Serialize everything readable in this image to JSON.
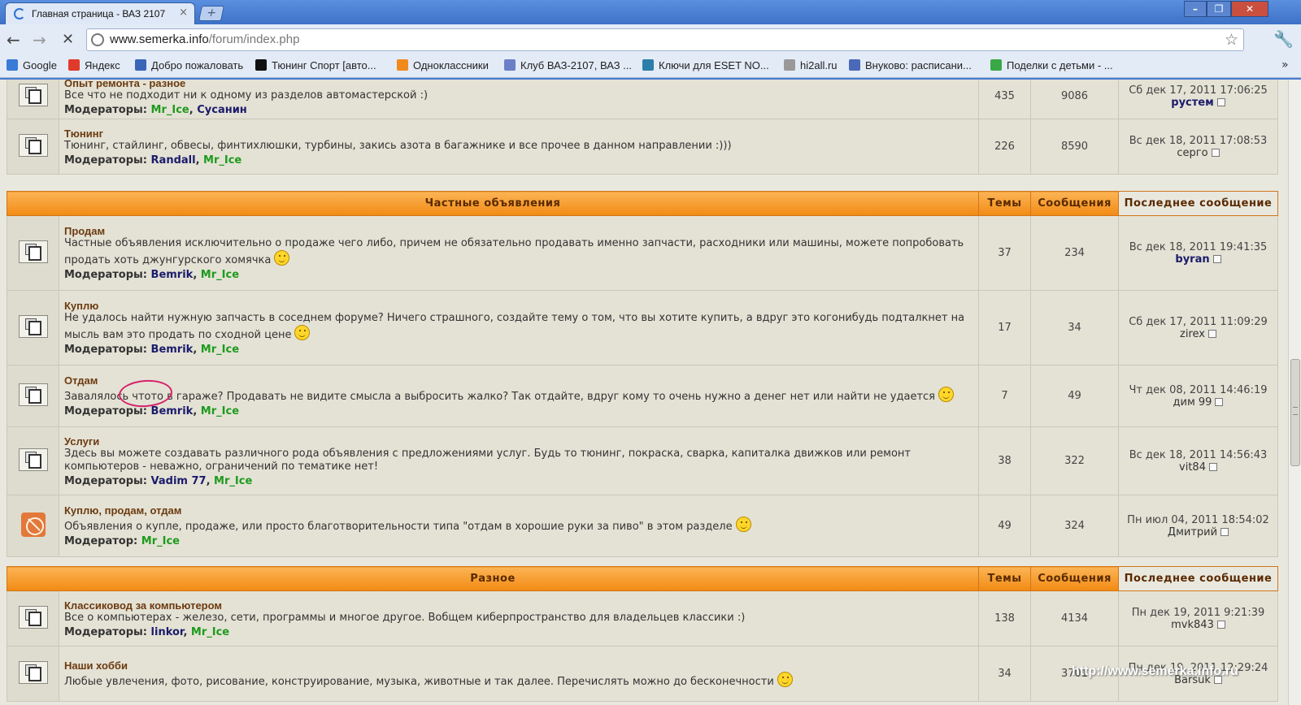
{
  "browser": {
    "tab_title": "Главная страница - ВАЗ 2107",
    "url_host": "www.semerka.info",
    "url_path": "/forum/index.php",
    "bookmarks": [
      {
        "label": "Google",
        "color": "#3a7bd5"
      },
      {
        "label": "Яндекс",
        "color": "#e03a2b"
      },
      {
        "label": "Добро пожаловать",
        "color": "#3a66b8"
      },
      {
        "label": "Тюнинг Спорт [авто...",
        "color": "#111111"
      },
      {
        "label": "Одноклассники",
        "color": "#f08a1d"
      },
      {
        "label": "Клуб ВАЗ-2107, ВАЗ ...",
        "color": "#6b7fc8"
      },
      {
        "label": "Ключи для ESET NO...",
        "color": "#2c7fa8"
      },
      {
        "label": "hi2all.ru",
        "color": "#999999"
      },
      {
        "label": "Внуково: расписани...",
        "color": "#4a69b8"
      },
      {
        "label": "Поделки с детьми - ...",
        "color": "#3aa845"
      }
    ]
  },
  "sections": [
    {
      "header": "",
      "forums": [
        {
          "title": "Опыт ремонта - разное",
          "description": "Все что не подходит ни к одному из разделов автомастерской :)",
          "smiley": false,
          "mods_label": "Модераторы:",
          "mods": [
            {
              "name": "Mr_Ice",
              "green": true
            },
            {
              "name": "Сусанин",
              "green": false
            }
          ],
          "topics": "435",
          "posts": "9086",
          "last_date": "Сб дек 17, 2011 17:06:25",
          "last_user": "рустем",
          "last_user_bold": true,
          "icon": "forum"
        },
        {
          "title": "Тюнинг",
          "description": "Тюнинг, стайлинг, обвесы, финтихлюшки, турбины, закись азота в багажнике и все прочее в данном направлении :)))",
          "smiley": false,
          "mods_label": "Модераторы:",
          "mods": [
            {
              "name": "Randall",
              "green": false
            },
            {
              "name": "Mr_Ice",
              "green": true
            }
          ],
          "topics": "226",
          "posts": "8590",
          "last_date": "Вс дек 18, 2011 17:08:53",
          "last_user": "серго",
          "last_user_bold": false,
          "icon": "forum"
        }
      ]
    },
    {
      "header": "Частные объявления",
      "col_topics": "Темы",
      "col_posts": "Сообщения",
      "col_last": "Последнее сообщение",
      "forums": [
        {
          "title": "Продам",
          "description": "Частные объявления исключительно о продаже чего либо, причем не обязательно продавать именно запчасти, расходники или машины, можете попробовать продать хоть джунгурского хомячка",
          "smiley": true,
          "mods_label": "Модераторы:",
          "mods": [
            {
              "name": "Bemrik",
              "green": false
            },
            {
              "name": "Mr_Ice",
              "green": true
            }
          ],
          "topics": "37",
          "posts": "234",
          "last_date": "Вс дек 18, 2011 19:41:35",
          "last_user": "byran",
          "last_user_bold": true,
          "icon": "forum"
        },
        {
          "title": "Куплю",
          "description": "Не удалось найти нужную запчасть в соседнем форуме? Ничего страшного, создайте тему о том, что вы хотите купить, а вдруг это когонибудь подталкнет на мысль вам это продать по сходной цене",
          "smiley": true,
          "mods_label": "Модераторы:",
          "mods": [
            {
              "name": "Bemrik",
              "green": false
            },
            {
              "name": "Mr_Ice",
              "green": true
            }
          ],
          "topics": "17",
          "posts": "34",
          "last_date": "Сб дек 17, 2011 11:09:29",
          "last_user": "zirex",
          "last_user_bold": false,
          "icon": "forum"
        },
        {
          "title": "Отдам",
          "description": "Завалялось чтото в гараже? Продавать не видите смысла а выбросить жалко? Так отдайте, вдруг кому то очень нужно а денег нет или найти не удается",
          "smiley": true,
          "mods_label": "Модераторы:",
          "mods": [
            {
              "name": "Bemrik",
              "green": false
            },
            {
              "name": "Mr_Ice",
              "green": true
            }
          ],
          "topics": "7",
          "posts": "49",
          "last_date": "Чт дек 08, 2011 14:46:19",
          "last_user": "дим 99",
          "last_user_bold": false,
          "icon": "forum"
        },
        {
          "title": "Услуги",
          "description": "Здесь вы можете создавать различного рода объявления с предложениями услуг. Будь то тюнинг, покраска, сварка, капиталка движков или ремонт компьютеров - неважно, ограничений по тематике нет!",
          "smiley": false,
          "mods_label": "Модераторы:",
          "mods": [
            {
              "name": "Vadim 77",
              "green": false
            },
            {
              "name": "Mr_Ice",
              "green": true
            }
          ],
          "topics": "38",
          "posts": "322",
          "last_date": "Вс дек 18, 2011 14:56:43",
          "last_user": "vit84",
          "last_user_bold": false,
          "icon": "forum"
        },
        {
          "title": "Куплю, продам, отдам",
          "description": "Объявления о купле, продаже, или просто благотворительности типа \"отдам в хорошие руки за пиво\" в этом разделе",
          "smiley": true,
          "mods_label": "Модератор:",
          "mods": [
            {
              "name": "Mr_Ice",
              "green": true
            }
          ],
          "topics": "49",
          "posts": "324",
          "last_date": "Пн июл 04, 2011 18:54:02",
          "last_user": "Дмитрий",
          "last_user_bold": false,
          "icon": "locked"
        }
      ]
    },
    {
      "header": "Разное",
      "col_topics": "Темы",
      "col_posts": "Сообщения",
      "col_last": "Последнее сообщение",
      "forums": [
        {
          "title": "Классиковод за компьютером",
          "description": "Все о компьютерах - железо, сети, программы и многое другое. Вобщем киберпространство для владельцев классики :)",
          "smiley": false,
          "mods_label": "Модераторы:",
          "mods": [
            {
              "name": "linkor",
              "green": false
            },
            {
              "name": "Mr_Ice",
              "green": true
            }
          ],
          "topics": "138",
          "posts": "4134",
          "last_date": "Пн дек 19, 2011 9:21:39",
          "last_user": "mvk843",
          "last_user_bold": false,
          "icon": "forum"
        },
        {
          "title": "Наши хобби",
          "description": "Любые увлечения, фото, рисование, конструирование, музыка, животные и так далее. Перечислять можно до бесконечности",
          "smiley": true,
          "mods_label": "",
          "mods": [],
          "topics": "34",
          "posts": "3701",
          "last_date": "Пн дек 19, 2011 12:29:24",
          "last_user": "Barsuk",
          "last_user_bold": false,
          "icon": "forum"
        }
      ]
    }
  ],
  "watermark": "http://www.semerka.info.ru"
}
